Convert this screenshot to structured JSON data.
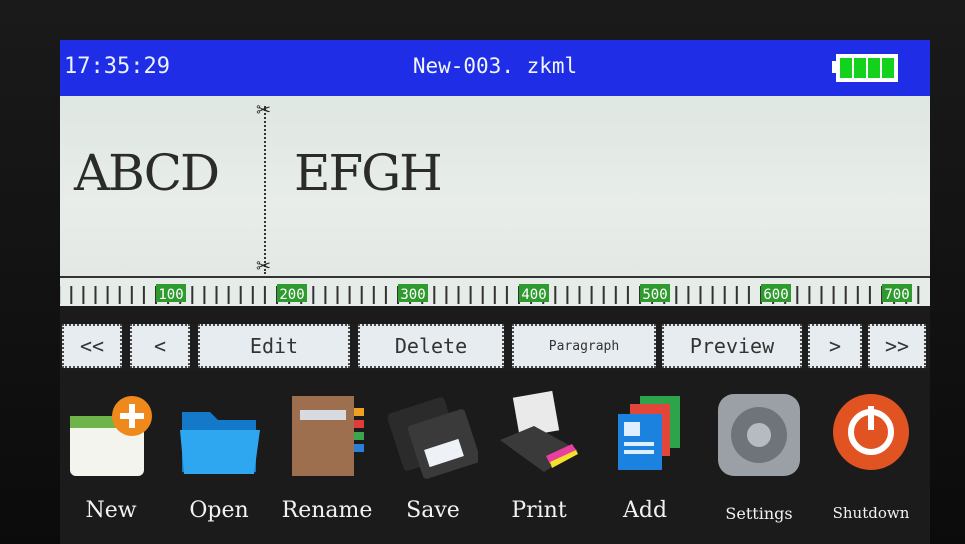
{
  "status": {
    "time": "17:35:29",
    "filename": "New-003. zkml",
    "battery_cells": 4,
    "battery_color": "#13d21b"
  },
  "label": {
    "text_left": "ABCD",
    "text_right": "EFGH"
  },
  "ruler": {
    "ticks": [
      "100",
      "200",
      "300",
      "400",
      "500",
      "600",
      "700"
    ]
  },
  "toolbar": {
    "first": "<<",
    "prev": "<",
    "edit": "Edit",
    "delete": "Delete",
    "paragraph": "Paragraph",
    "preview": "Preview",
    "next": ">",
    "last": ">>"
  },
  "apps": [
    {
      "label": "New",
      "icon": "new-file-icon"
    },
    {
      "label": "Open",
      "icon": "folder-icon"
    },
    {
      "label": "Rename",
      "icon": "book-icon"
    },
    {
      "label": "Save",
      "icon": "floppy-disk-icon"
    },
    {
      "label": "Print",
      "icon": "printer-icon"
    },
    {
      "label": "Add",
      "icon": "add-pages-icon"
    },
    {
      "label": "Settings",
      "icon": "gear-icon"
    },
    {
      "label": "Shutdown",
      "icon": "power-icon"
    }
  ],
  "colors": {
    "statusbar": "#1f2de6",
    "ruler_label_bg": "#2f9b2f"
  }
}
